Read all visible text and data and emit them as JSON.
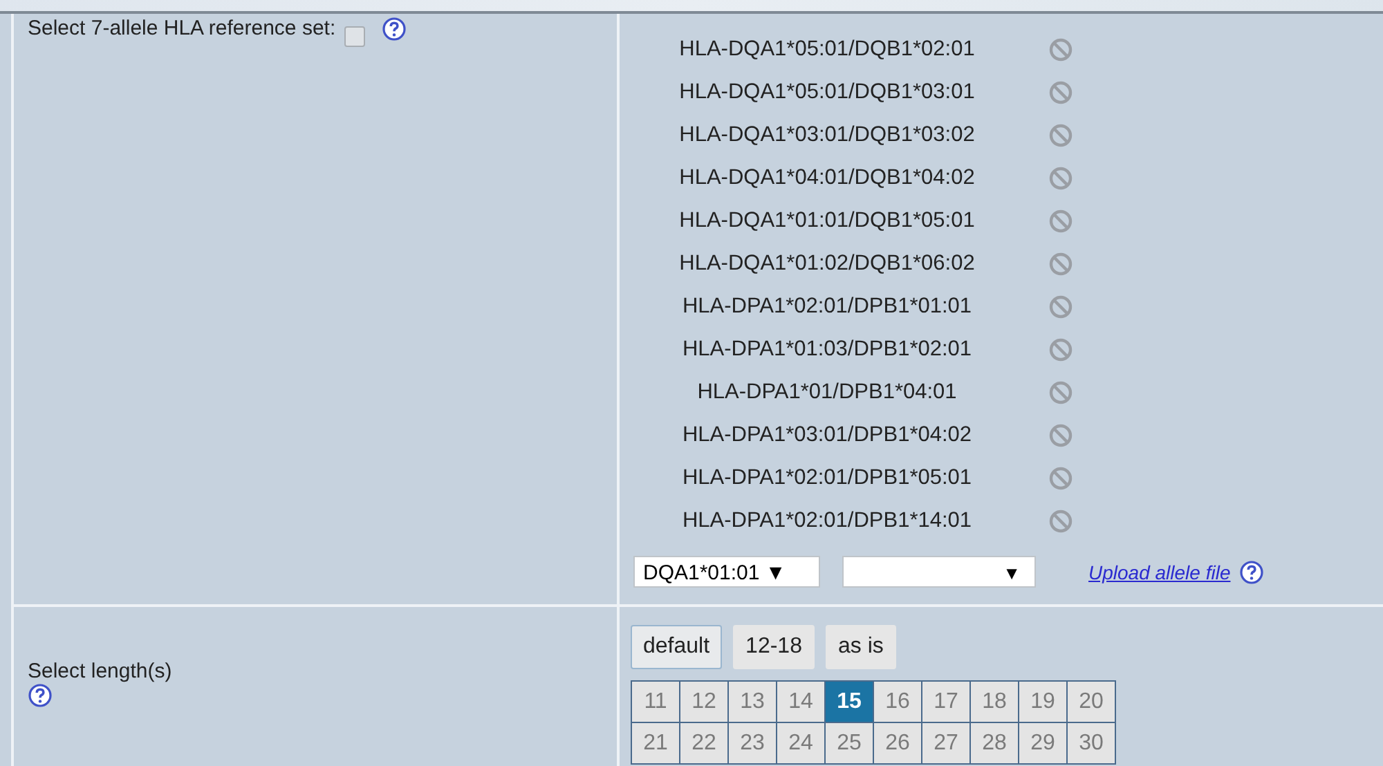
{
  "reference_set": {
    "label": "Select 7-allele HLA reference set:",
    "checked": false
  },
  "alleles": [
    "HLA-DQA1*05:01/DQB1*02:01",
    "HLA-DQA1*05:01/DQB1*03:01",
    "HLA-DQA1*03:01/DQB1*03:02",
    "HLA-DQA1*04:01/DQB1*04:02",
    "HLA-DQA1*01:01/DQB1*05:01",
    "HLA-DQA1*01:02/DQB1*06:02",
    "HLA-DPA1*02:01/DPB1*01:01",
    "HLA-DPA1*01:03/DPB1*02:01",
    "HLA-DPA1*01/DPB1*04:01",
    "HLA-DPA1*03:01/DPB1*04:02",
    "HLA-DPA1*02:01/DPB1*05:01",
    "HLA-DPA1*02:01/DPB1*14:01"
  ],
  "allele_select_1": {
    "value": "DQA1*01:01",
    "arrow": "▼"
  },
  "allele_select_2": {
    "arrow": "▼"
  },
  "upload_link": "Upload allele file",
  "length": {
    "label": "Select length(s)",
    "presets": [
      {
        "label": "default",
        "selected": true
      },
      {
        "label": "12-18",
        "selected": false
      },
      {
        "label": "as is",
        "selected": false
      }
    ],
    "values": [
      {
        "label": "11",
        "selected": false
      },
      {
        "label": "12",
        "selected": false
      },
      {
        "label": "13",
        "selected": false
      },
      {
        "label": "14",
        "selected": false
      },
      {
        "label": "15",
        "selected": true
      },
      {
        "label": "16",
        "selected": false
      },
      {
        "label": "17",
        "selected": false
      },
      {
        "label": "18",
        "selected": false
      },
      {
        "label": "19",
        "selected": false
      },
      {
        "label": "20",
        "selected": false
      },
      {
        "label": "21",
        "selected": false
      },
      {
        "label": "22",
        "selected": false
      },
      {
        "label": "23",
        "selected": false
      },
      {
        "label": "24",
        "selected": false
      },
      {
        "label": "25",
        "selected": false
      },
      {
        "label": "26",
        "selected": false
      },
      {
        "label": "27",
        "selected": false
      },
      {
        "label": "28",
        "selected": false
      },
      {
        "label": "29",
        "selected": false
      },
      {
        "label": "30",
        "selected": false
      }
    ]
  }
}
